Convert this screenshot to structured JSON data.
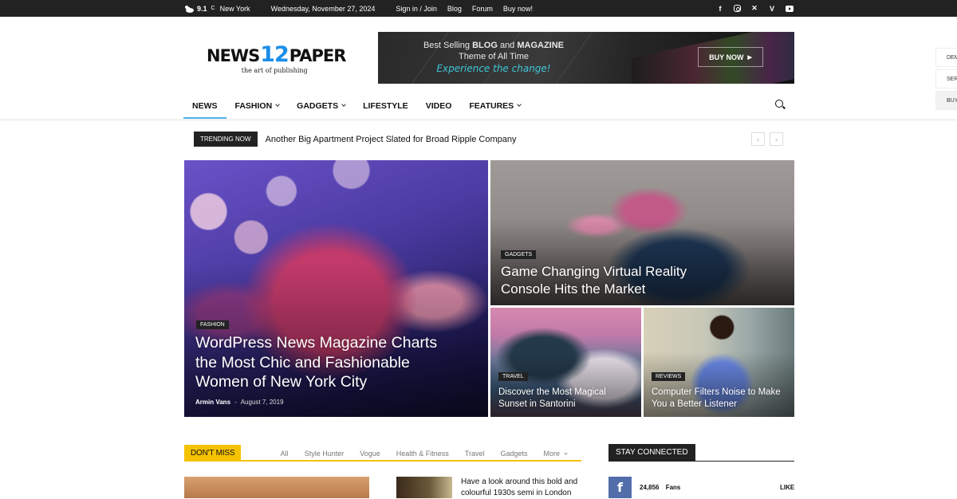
{
  "topbar": {
    "weather_icon": "cloud-sun-icon",
    "temperature": "9.1",
    "unit": "C",
    "city": "New York",
    "date": "Wednesday, November 27, 2024",
    "links": [
      "Sign in / Join",
      "Blog",
      "Forum",
      "Buy now!"
    ],
    "social": [
      "facebook-icon",
      "instagram-icon",
      "x-icon",
      "vimeo-icon",
      "youtube-icon"
    ]
  },
  "logo": {
    "word_left": "NEWS",
    "number": "12",
    "word_right": "PAPER",
    "tagline": "the art of publishing",
    "number_color": "#1a8ee8"
  },
  "banner": {
    "line1_pre": "Best Selling ",
    "line1_b1": "BLOG",
    "line1_mid": " and ",
    "line1_b2": "MAGAZINE",
    "line2": "Theme of All Time",
    "line3": "Experience the change!",
    "button": "BUY NOW"
  },
  "side_tabs": [
    "DEMOS",
    "SERVICES",
    "BUY"
  ],
  "nav": {
    "items": [
      {
        "label": "NEWS",
        "dropdown": false,
        "active": true
      },
      {
        "label": "FASHION",
        "dropdown": true
      },
      {
        "label": "GADGETS",
        "dropdown": true
      },
      {
        "label": "LIFESTYLE",
        "dropdown": false
      },
      {
        "label": "VIDEO",
        "dropdown": false
      },
      {
        "label": "FEATURES",
        "dropdown": true
      }
    ],
    "accent": "#4db2ec"
  },
  "trending": {
    "label": "TRENDING NOW",
    "headline": "Another Big Apartment Project Slated for Broad Ripple Company",
    "prev": "‹",
    "next": "›"
  },
  "featured": [
    {
      "category": "FASHION",
      "title": "WordPress News Magazine Charts the Most Chic and Fashionable Women of New York City",
      "author": "Armin Vans",
      "separator": "-",
      "date": "August 7, 2019"
    },
    {
      "category": "GADGETS",
      "title": "Game Changing Virtual Reality Console Hits the Market"
    },
    {
      "category": "TRAVEL",
      "title": "Discover the Most Magical Sunset in Santorini"
    },
    {
      "category": "REVIEWS",
      "title": "Computer Filters Noise to Make You a Better Listener"
    }
  ],
  "dont_miss": {
    "label": "DON'T MISS",
    "tabs": [
      "All",
      "Style Hunter",
      "Vogue",
      "Health & Fitness",
      "Travel",
      "Gadgets",
      "More"
    ],
    "accent": "#f5c200",
    "side_title": "Have a look around this bold and colourful 1930s semi in London"
  },
  "stay_connected": {
    "label": "STAY CONNECTED",
    "facebook": {
      "icon": "f",
      "count": "24,856",
      "unit": "Fans",
      "action": "LIKE",
      "color": "#516eab"
    }
  }
}
